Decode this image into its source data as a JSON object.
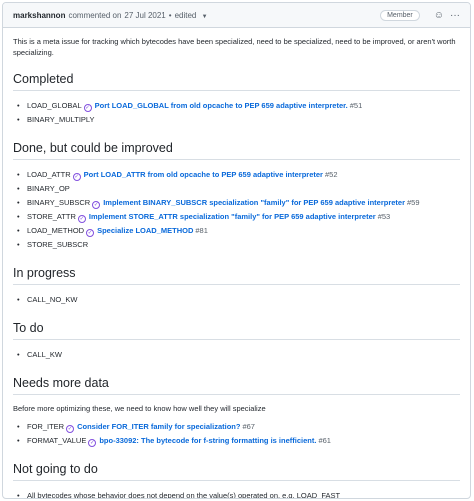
{
  "header": {
    "author": "markshannon",
    "action": "commented on",
    "date": "27 Jul 2021",
    "separator": "•",
    "edited": "edited",
    "role_badge": "Member",
    "emoji_icon": "smiley-icon",
    "menu_icon": "kebab-horizontal-icon"
  },
  "intro": "This is a meta issue for tracking which bytecodes have been specialized, need to be specialized, need to be improved, or aren't worth specializing.",
  "sections": [
    {
      "title": "Completed",
      "items": [
        {
          "text": "LOAD_GLOBAL",
          "link": "Port LOAD_GLOBAL from old opcache to PEP 659 adaptive interpreter.",
          "num": "#51"
        },
        {
          "text": "BINARY_MULTIPLY"
        }
      ]
    },
    {
      "title": "Done, but could be improved",
      "items": [
        {
          "text": "LOAD_ATTR",
          "link": "Port LOAD_ATTR from old opcache to PEP 659 adaptive interpreter",
          "num": "#52"
        },
        {
          "text": "BINARY_OP"
        },
        {
          "text": "BINARY_SUBSCR",
          "link": "Implement BINARY_SUBSCR specialization \"family\" for PEP 659 adaptive interpreter",
          "num": "#59"
        },
        {
          "text": "STORE_ATTR",
          "link": "Implement STORE_ATTR specialization \"family\" for PEP 659 adaptive interpreter",
          "num": "#53"
        },
        {
          "text": "LOAD_METHOD",
          "link": "Specialize LOAD_METHOD",
          "num": "#81"
        },
        {
          "text": "STORE_SUBSCR"
        }
      ]
    },
    {
      "title": "In progress",
      "items": [
        {
          "text": "CALL_NO_KW"
        }
      ]
    },
    {
      "title": "To do",
      "items": [
        {
          "text": "CALL_KW"
        }
      ]
    },
    {
      "title": "Needs more data",
      "note": "Before more optimizing these, we need to know how well they will specialize",
      "items": [
        {
          "text": "FOR_ITER",
          "link": "Consider FOR_ITER family for specialization?",
          "num": "#67"
        },
        {
          "text": "FORMAT_VALUE",
          "link": "bpo-33092: The bytecode for f-string formatting is inefficient.",
          "num": "#61"
        }
      ]
    },
    {
      "title": "Not going to do",
      "items": [
        {
          "text": "All bytecodes whose behavior does not depend on the value(s) operated on, e.g. LOAD_FAST"
        }
      ]
    }
  ],
  "issue_icon": "issue-closed-icon",
  "colors": {
    "link": "#0969da",
    "closed_icon": "#8250df",
    "border": "#d0d7de"
  }
}
